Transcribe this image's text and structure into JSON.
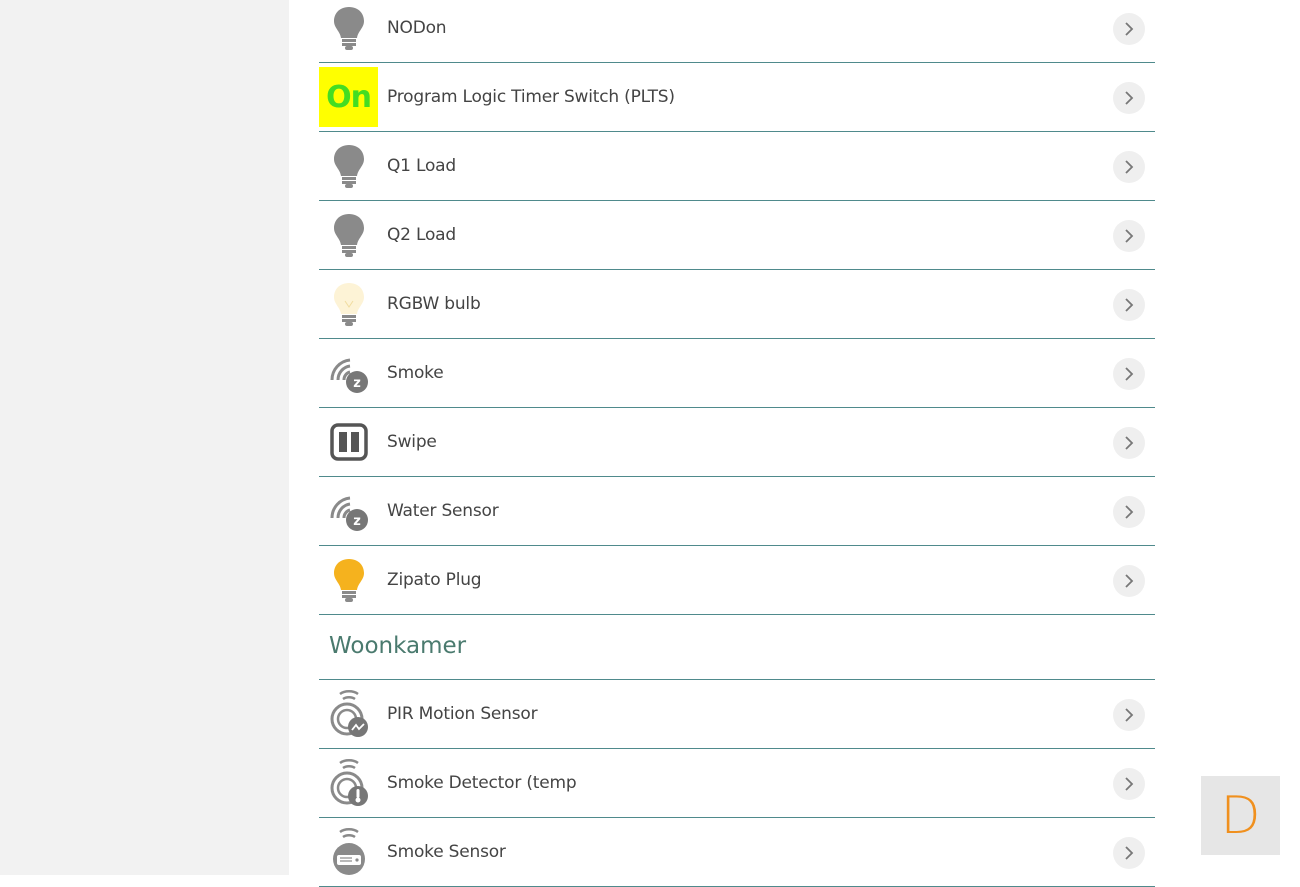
{
  "devices": [
    {
      "label": "NODon",
      "icon": "bulb-gray-icon"
    },
    {
      "label": "Program Logic Timer Switch (PLTS)",
      "icon": "on-badge",
      "badge_text": "On"
    },
    {
      "label": "Q1 Load",
      "icon": "bulb-gray-icon"
    },
    {
      "label": "Q2 Load",
      "icon": "bulb-gray-icon"
    },
    {
      "label": "RGBW bulb",
      "icon": "bulb-pale-icon"
    },
    {
      "label": "Smoke",
      "icon": "zwave-signal-icon"
    },
    {
      "label": "Swipe",
      "icon": "swipe-panel-icon"
    },
    {
      "label": "Water Sensor",
      "icon": "zwave-signal-icon"
    },
    {
      "label": "Zipato Plug",
      "icon": "bulb-yellow-icon"
    }
  ],
  "section": {
    "title": "Woonkamer",
    "devices": [
      {
        "label": "PIR Motion Sensor",
        "icon": "motion-sensor-icon"
      },
      {
        "label": "Smoke Detector (temp",
        "icon": "temperature-sensor-icon"
      },
      {
        "label": "Smoke Sensor",
        "icon": "smoke-sensor-icon"
      }
    ]
  },
  "floating_button": {
    "label": "D"
  },
  "colors": {
    "divider": "#4f8a8c",
    "section_title": "#4a7a6e",
    "on_badge_bg": "#ffff00",
    "on_badge_text": "#44dd22",
    "bulb_gray": "#8a8a8a",
    "bulb_yellow": "#f5b21e",
    "floating_button_text": "#f0901e"
  }
}
